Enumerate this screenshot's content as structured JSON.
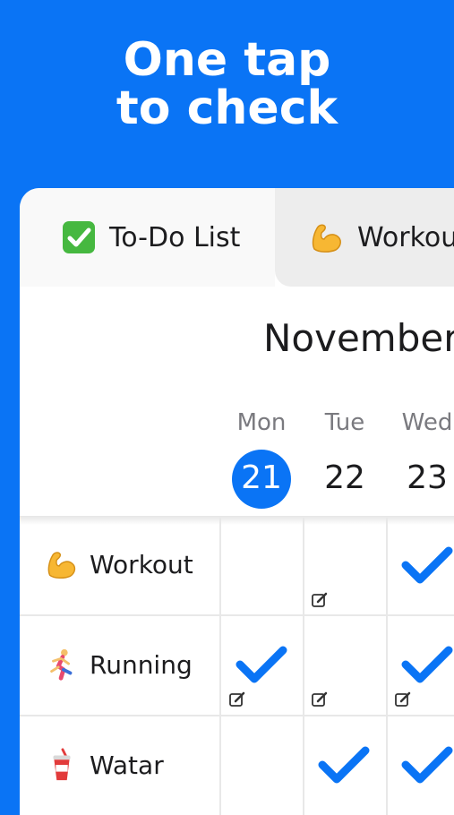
{
  "headline": [
    "One tap",
    "to check"
  ],
  "tabs": [
    {
      "label": "To-Do List",
      "icon": "check-mark-box-icon"
    },
    {
      "label": "Workout",
      "icon": "flexed-biceps-icon"
    }
  ],
  "month": "November",
  "days": [
    {
      "name": "Mon",
      "num": "21",
      "today": true
    },
    {
      "name": "Tue",
      "num": "22",
      "today": false
    },
    {
      "name": "Wed",
      "num": "23",
      "today": false
    }
  ],
  "rows": [
    {
      "label": "Workout",
      "icon": "flexed-biceps-icon"
    },
    {
      "label": "Running",
      "icon": "person-running-icon"
    },
    {
      "label": "Watar",
      "icon": "cup-with-straw-icon"
    }
  ],
  "colors": {
    "accent": "#0a74f5",
    "check": "#0a74f5"
  }
}
